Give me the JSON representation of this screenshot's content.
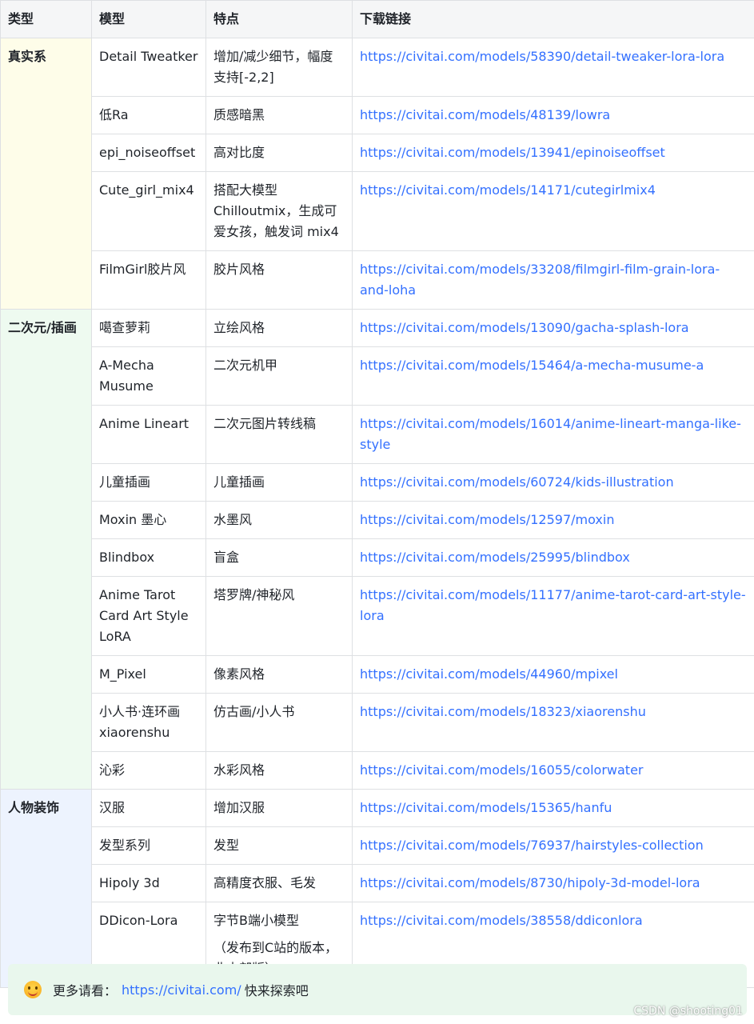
{
  "table": {
    "headers": [
      "类型",
      "模型",
      "特点",
      "下载链接"
    ],
    "groups": [
      {
        "category": "真实系",
        "rows": [
          {
            "model": "Detail Tweatker",
            "feature": "增加/减少细节，幅度支持[-2,2]",
            "link": "https://civitai.com/models/58390/detail-tweaker-lora-lora"
          },
          {
            "model": "低Ra",
            "feature": "质感暗黑",
            "link": "https://civitai.com/models/48139/lowra"
          },
          {
            "model": "epi_noiseoffset",
            "feature": "高对比度",
            "link": "https://civitai.com/models/13941/epinoiseoffset"
          },
          {
            "model": "Cute_girl_mix4",
            "feature": "搭配大模型Chilloutmix，生成可爱女孩，触发词 mix4",
            "link": "https://civitai.com/models/14171/cutegirlmix4"
          },
          {
            "model": "FilmGirl胶片风",
            "feature": "胶片风格",
            "link": "https://civitai.com/models/33208/filmgirl-film-grain-lora-and-loha"
          }
        ]
      },
      {
        "category": "二次元/插画",
        "rows": [
          {
            "model": "噶查萝莉",
            "feature": "立绘风格",
            "link": "https://civitai.com/models/13090/gacha-splash-lora"
          },
          {
            "model": "A-Mecha Musume",
            "feature": "二次元机甲",
            "link": "https://civitai.com/models/15464/a-mecha-musume-a"
          },
          {
            "model": "Anime Lineart",
            "feature": "二次元图片转线稿",
            "link": "https://civitai.com/models/16014/anime-lineart-manga-like-style"
          },
          {
            "model": "儿童插画",
            "feature": "儿童插画",
            "link": "https://civitai.com/models/60724/kids-illustration"
          },
          {
            "model": "Moxin 墨心",
            "feature": "水墨风",
            "link": "https://civitai.com/models/12597/moxin"
          },
          {
            "model": "Blindbox",
            "feature": "盲盒",
            "link": "https://civitai.com/models/25995/blindbox"
          },
          {
            "model": "Anime Tarot Card Art Style LoRA",
            "feature": "塔罗牌/神秘风",
            "link": "https://civitai.com/models/11177/anime-tarot-card-art-style-lora"
          },
          {
            "model": "M_Pixel",
            "feature": "像素风格",
            "link": "https://civitai.com/models/44960/mpixel"
          },
          {
            "model": "小人书·连环画 xiaorenshu",
            "feature": "仿古画/小人书",
            "link": "https://civitai.com/models/18323/xiaorenshu"
          },
          {
            "model": "沁彩",
            "feature": "水彩风格",
            "link": "https://civitai.com/models/16055/colorwater"
          }
        ]
      },
      {
        "category": "人物装饰",
        "rows": [
          {
            "model": "汉服",
            "feature": "增加汉服",
            "link": "https://civitai.com/models/15365/hanfu"
          },
          {
            "model": "发型系列",
            "feature": "发型",
            "link": "https://civitai.com/models/76937/hairstyles-collection"
          },
          {
            "model": "Hipoly 3d",
            "feature": "高精度衣服、毛发",
            "link": "https://civitai.com/models/8730/hipoly-3d-model-lora"
          },
          {
            "model": "DDicon-Lora",
            "feature": "字节B端小模型",
            "feature_extra": "（发布到C站的版本，非内部版）",
            "link": "https://civitai.com/models/38558/ddiconlora"
          }
        ]
      }
    ]
  },
  "callout": {
    "icon": "smile-emoji-icon",
    "label": "更多请看：",
    "link": "https://civitai.com/",
    "tail": "快来探索吧",
    "background": "#e9f7ed"
  },
  "footer": {
    "mark": "CSDN @shooting01"
  },
  "colors": {
    "link": "#3370ff",
    "border": "#dee0e3",
    "cat_realistic_bg": "#fefde9",
    "cat_anime_bg": "#eefaf0",
    "cat_decor_bg": "#edf3fe"
  }
}
